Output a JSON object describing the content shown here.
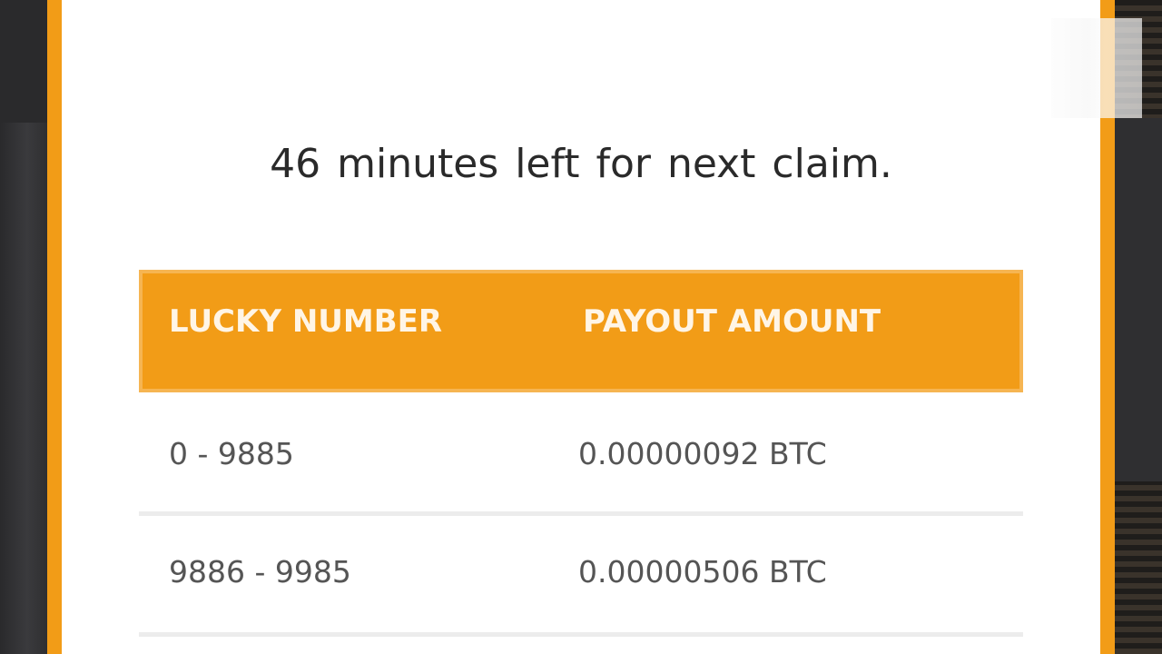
{
  "message": "46 minutes left for next claim.",
  "table": {
    "headers": [
      "LUCKY NUMBER",
      "PAYOUT AMOUNT"
    ],
    "rows": [
      [
        "0 - 9885",
        "0.00000092 BTC"
      ],
      [
        "9886 - 9985",
        "0.00000506 BTC"
      ]
    ]
  },
  "colors": {
    "accent": "#f29c17"
  }
}
